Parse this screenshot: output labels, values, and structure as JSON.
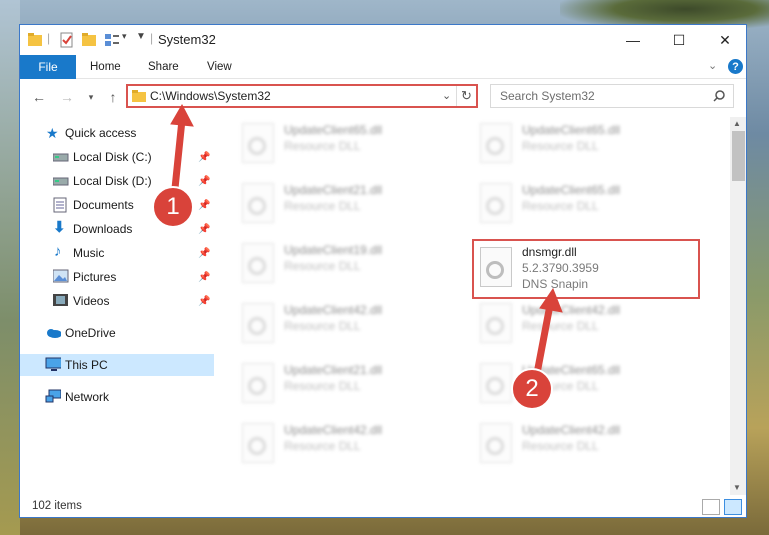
{
  "window": {
    "title": "System32",
    "controls": {
      "minimize": "—",
      "maximize": "☐",
      "close": "✕"
    }
  },
  "ribbon": {
    "tabs": [
      "File",
      "Home",
      "Share",
      "View"
    ],
    "help": "?"
  },
  "address": {
    "path": "C:\\Windows\\System32",
    "search_placeholder": "Search System32"
  },
  "nav": {
    "quick_access": "Quick access",
    "items": [
      {
        "label": "Local Disk (C:)",
        "icon": "drive-icon",
        "pinned": true
      },
      {
        "label": "Local Disk (D:)",
        "icon": "drive-icon",
        "pinned": true
      },
      {
        "label": "Documents",
        "icon": "documents-icon",
        "pinned": true
      },
      {
        "label": "Downloads",
        "icon": "downloads-icon",
        "pinned": true
      },
      {
        "label": "Music",
        "icon": "music-icon",
        "pinned": true
      },
      {
        "label": "Pictures",
        "icon": "pictures-icon",
        "pinned": true
      },
      {
        "label": "Videos",
        "icon": "videos-icon",
        "pinned": true
      }
    ],
    "onedrive": "OneDrive",
    "this_pc": "This PC",
    "network": "Network"
  },
  "files": {
    "left": [
      {
        "name": "UpdateClient65.dll",
        "type": "Resource DLL"
      },
      {
        "name": "UpdateClient21.dll",
        "type": "Resource DLL"
      },
      {
        "name": "UpdateClient19.dll",
        "type": "Resource DLL"
      },
      {
        "name": "UpdateClient42.dll",
        "type": "Resource DLL"
      },
      {
        "name": "UpdateClient21.dll",
        "type": "Resource DLL"
      },
      {
        "name": "UpdateClient42.dll",
        "type": "Resource DLL"
      }
    ],
    "right": [
      {
        "name": "UpdateClient65.dll",
        "type": "Resource DLL"
      },
      {
        "name": "UpdateClient65.dll",
        "type": "Resource DLL"
      },
      {
        "name": "UpdateClient42.dll",
        "type": "Resource DLL"
      },
      {
        "name": "UpdateClient65.dll",
        "type": "Resource DLL"
      },
      {
        "name": "UpdateClient42.dll",
        "type": "Resource DLL"
      }
    ],
    "highlighted": {
      "name": "dnsmgr.dll",
      "version": "5.2.3790.3959",
      "type": "DNS Snapin"
    }
  },
  "status": {
    "count": "102 items"
  },
  "annotations": {
    "step1": "1",
    "step2": "2",
    "color": "#d9433a"
  }
}
